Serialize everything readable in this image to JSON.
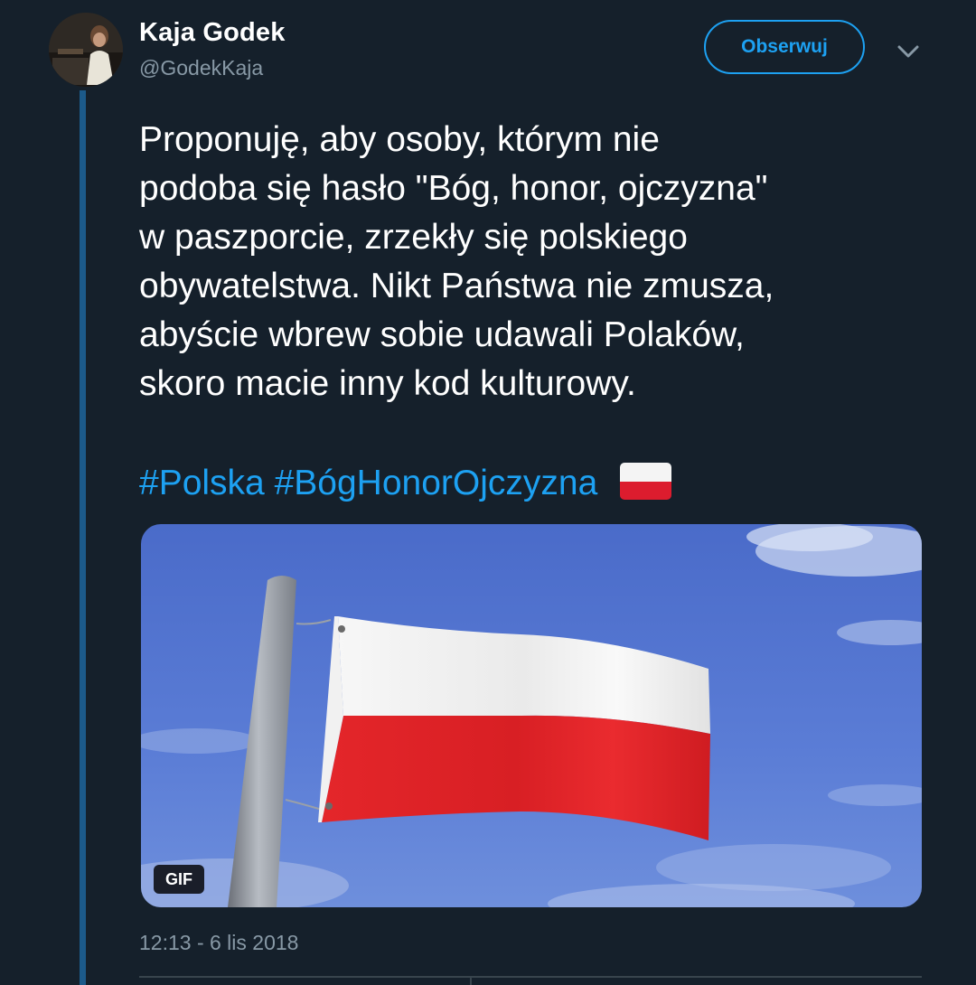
{
  "tweet": {
    "author_name": "Kaja Godek",
    "author_handle": "@GodekKaja",
    "follow_label": "Obserwuj",
    "text_lines": [
      "Proponuję, aby osoby, którym nie",
      "podoba się hasło \"Bóg, honor, ojczyzna\"",
      "w paszporcie, zrzekły się polskiego",
      "obywatelstwa. Nikt Państwa nie zmusza,",
      "abyście wbrew sobie udawali Polaków,",
      "skoro macie inny kod kulturowy."
    ],
    "hashtags": [
      "#Polska",
      "#BógHonorOjczyzna"
    ],
    "emoji": "flag-poland",
    "media": {
      "type": "gif",
      "badge_label": "GIF"
    },
    "timestamp": "12:13 - 6 lis 2018"
  },
  "colors": {
    "background": "#15202b",
    "accent": "#1da1f2",
    "secondary_text": "#8899a6",
    "thread_line": "#1c5a8a"
  },
  "icons": {
    "menu": "chevron-down-icon"
  }
}
